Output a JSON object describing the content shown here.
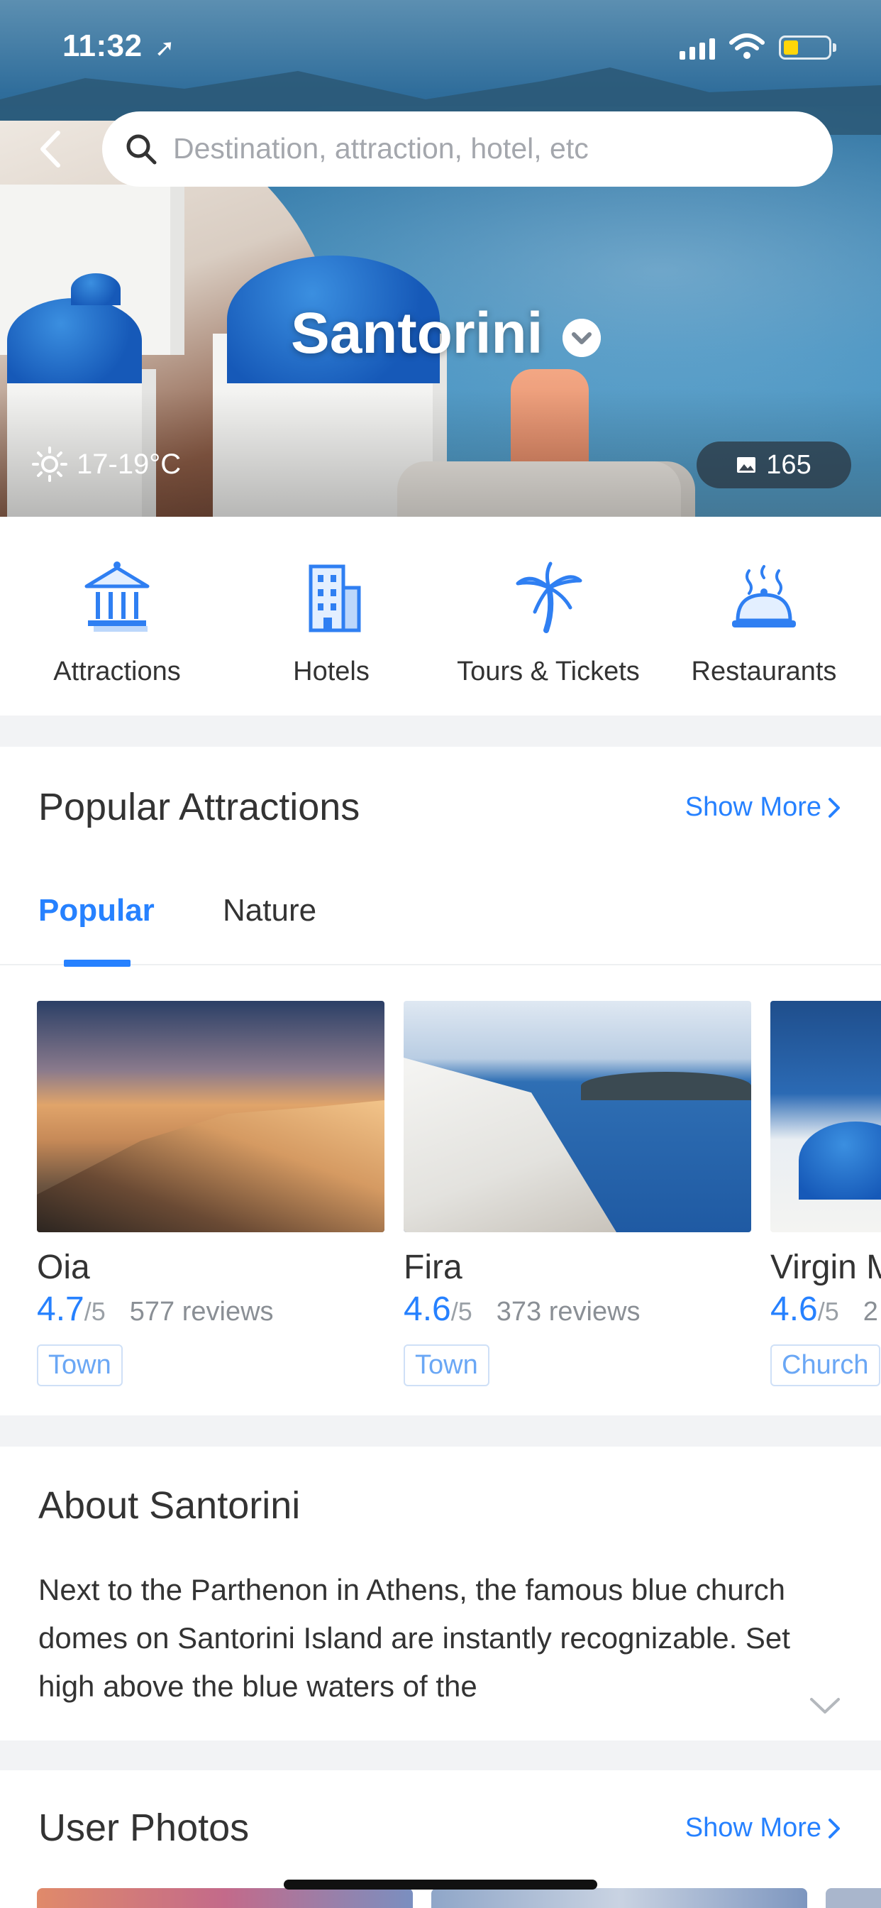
{
  "status_bar": {
    "time": "11:32"
  },
  "search": {
    "placeholder": "Destination, attraction, hotel, etc"
  },
  "hero": {
    "city": "Santorini",
    "weather": "17-19°C",
    "photo_count": "165"
  },
  "categories": [
    {
      "label": "Attractions",
      "icon": "temple-icon"
    },
    {
      "label": "Hotels",
      "icon": "building-icon"
    },
    {
      "label": "Tours & Tickets",
      "icon": "palm-tree-icon"
    },
    {
      "label": "Restaurants",
      "icon": "dish-cloche-icon"
    }
  ],
  "popular_attractions": {
    "title": "Popular Attractions",
    "show_more": "Show More",
    "tabs": [
      {
        "label": "Popular",
        "active": true
      },
      {
        "label": "Nature",
        "active": false
      }
    ],
    "items": [
      {
        "name": "Oia",
        "score": "4.7",
        "out_of": "/5",
        "reviews": "577 reviews",
        "tag": "Town"
      },
      {
        "name": "Fira",
        "score": "4.6",
        "out_of": "/5",
        "reviews": "373 reviews",
        "tag": "Town"
      },
      {
        "name": "Virgin M",
        "score": "4.6",
        "out_of": "/5",
        "reviews": "2",
        "tag": "Church"
      }
    ]
  },
  "about": {
    "title": "About Santorini",
    "text": "Next to the Parthenon in Athens, the famous blue church domes on Santorini Island are instantly recognizable. Set high above the blue waters of the"
  },
  "user_photos": {
    "title": "User Photos",
    "show_more": "Show More"
  },
  "colors": {
    "accent": "#2681ff",
    "tag_border": "#cfe0f7",
    "tag_text": "#6aa7f5",
    "battery": "#ffd60a"
  }
}
